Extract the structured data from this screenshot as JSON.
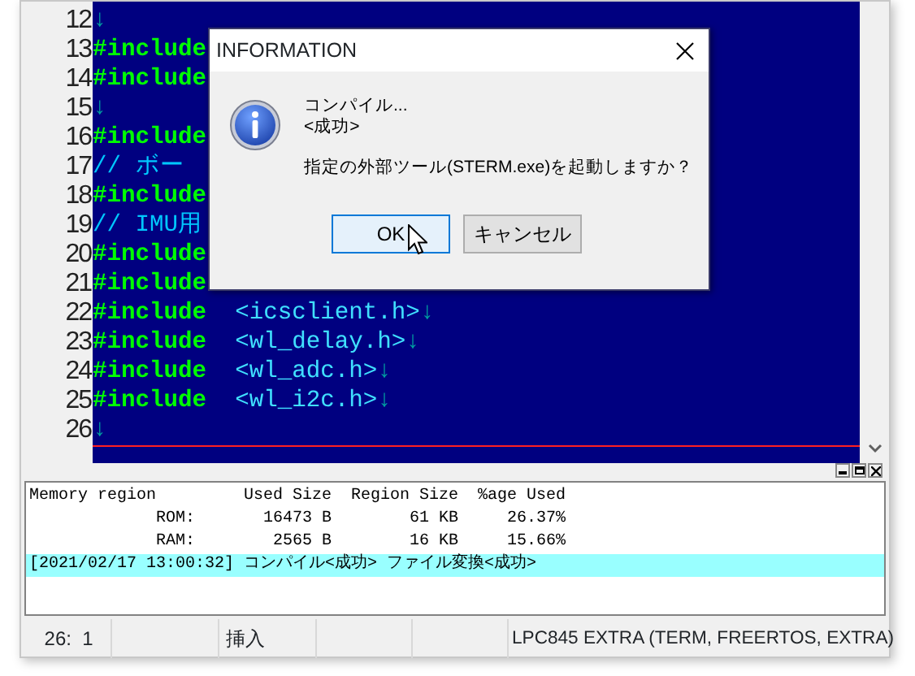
{
  "editor": {
    "lines": [
      {
        "number": "12",
        "cursor": false,
        "segments": [
          {
            "kind": "eol",
            "text": "↓"
          }
        ]
      },
      {
        "number": "13",
        "cursor": false,
        "segments": [
          {
            "kind": "directive",
            "text": "#include"
          }
        ]
      },
      {
        "number": "14",
        "cursor": false,
        "segments": [
          {
            "kind": "directive",
            "text": "#include"
          }
        ]
      },
      {
        "number": "15",
        "cursor": false,
        "segments": [
          {
            "kind": "eol",
            "text": "↓"
          }
        ]
      },
      {
        "number": "16",
        "cursor": false,
        "segments": [
          {
            "kind": "directive",
            "text": "#include"
          }
        ]
      },
      {
        "number": "17",
        "cursor": false,
        "segments": [
          {
            "kind": "comment",
            "text": "// ボー"
          }
        ]
      },
      {
        "number": "18",
        "cursor": false,
        "segments": [
          {
            "kind": "directive",
            "text": "#include"
          }
        ]
      },
      {
        "number": "19",
        "cursor": false,
        "segments": [
          {
            "kind": "comment",
            "text": "// IMU用"
          }
        ]
      },
      {
        "number": "20",
        "cursor": false,
        "segments": [
          {
            "kind": "directive",
            "text": "#include"
          }
        ]
      },
      {
        "number": "21",
        "cursor": false,
        "segments": [
          {
            "kind": "directive",
            "text": "#include"
          }
        ]
      },
      {
        "number": "22",
        "cursor": false,
        "segments": [
          {
            "kind": "directive",
            "text": "#include"
          },
          {
            "kind": "header",
            "text": "  <icsclient.h>"
          },
          {
            "kind": "eol",
            "text": "↓"
          }
        ]
      },
      {
        "number": "23",
        "cursor": false,
        "segments": [
          {
            "kind": "directive",
            "text": "#include"
          },
          {
            "kind": "header",
            "text": "  <wl_delay.h>"
          },
          {
            "kind": "eol",
            "text": "↓"
          }
        ]
      },
      {
        "number": "24",
        "cursor": false,
        "segments": [
          {
            "kind": "directive",
            "text": "#include"
          },
          {
            "kind": "header",
            "text": "  <wl_adc.h>"
          },
          {
            "kind": "eol",
            "text": "↓"
          }
        ]
      },
      {
        "number": "25",
        "cursor": false,
        "segments": [
          {
            "kind": "directive",
            "text": "#include"
          },
          {
            "kind": "header",
            "text": "  <wl_i2c.h>"
          },
          {
            "kind": "eol",
            "text": "↓"
          }
        ]
      },
      {
        "number": "26",
        "cursor": true,
        "segments": [
          {
            "kind": "eol",
            "text": "↓"
          }
        ]
      }
    ]
  },
  "dialog": {
    "title": "INFORMATION",
    "messages": [
      "コンパイル...",
      "<成功>",
      "指定の外部ツール(STERM.exe)を起動しますか？"
    ],
    "buttons": [
      {
        "label": "OK",
        "focused": true
      },
      {
        "label": "キャンセル",
        "focused": false
      }
    ]
  },
  "output": {
    "lines": [
      {
        "text": "Memory region         Used Size  Region Size  %age Used",
        "highlighted": false
      },
      {
        "text": "             ROM:       16473 B        61 KB     26.37%",
        "highlighted": false
      },
      {
        "text": "             RAM:        2565 B        16 KB     15.66%",
        "highlighted": false
      },
      {
        "text": "[2021/02/17 13:00:32] コンパイル<成功> ファイル変換<成功>",
        "highlighted": true
      }
    ]
  },
  "status_bar": {
    "position": "26:  1",
    "mode": "挿入",
    "target": "LPC845 EXTRA (TERM, FREERTOS, EXTRA)"
  }
}
